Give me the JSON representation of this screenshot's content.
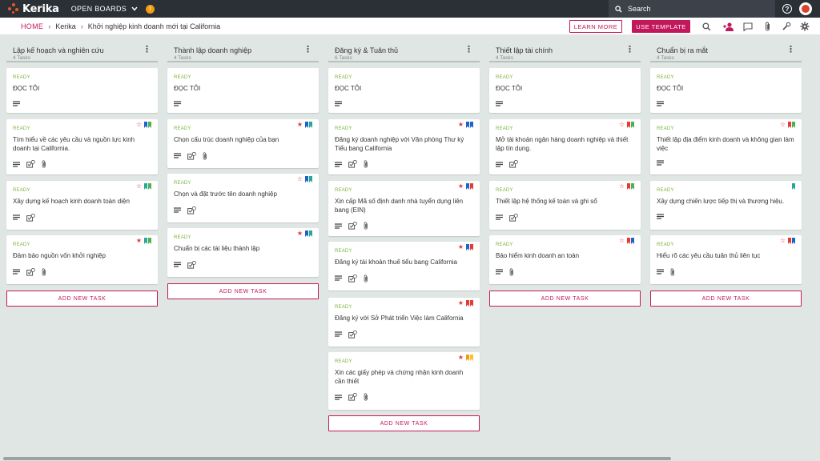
{
  "app": {
    "name": "Kerika",
    "open_boards": "OPEN BOARDS",
    "notification_icon": "lightbulb-icon"
  },
  "search": {
    "placeholder": "Search"
  },
  "breadcrumb": {
    "home": "HOME",
    "org": "Kerika",
    "board": "Khởi nghiệp kinh doanh mới tại California"
  },
  "toolbar": {
    "learn_more": "LEARN MORE",
    "use_template": "USE TEMPLATE"
  },
  "colors": {
    "accent": "#c2185b",
    "ready": "#7cb342",
    "red": "#e53935",
    "blue": "#1e63c8",
    "green": "#4caf50",
    "teal": "#26a69a",
    "orange": "#f39c12",
    "yellow": "#fbc02d"
  },
  "add_task_label": "ADD NEW TASK",
  "columns": [
    {
      "title": "Lập kế hoạch và nghiên cứu",
      "count": "4 Tasks",
      "cards": [
        {
          "status": "READY",
          "title": "ĐỌC TÔI",
          "star": "",
          "tags": []
        },
        {
          "status": "READY",
          "title": "Tìm hiểu về các yêu cầu và nguồn lực kinh doanh tại California.",
          "star": "outline",
          "tags": [
            "blue",
            "green"
          ]
        },
        {
          "status": "READY",
          "title": "Xây dựng kế hoạch kinh doanh toàn diện",
          "star": "outline",
          "tags": [
            "teal",
            "green"
          ]
        },
        {
          "status": "READY",
          "title": "Đảm bảo nguồn vốn khởi nghiệp",
          "star": "filled",
          "tags": [
            "teal",
            "green"
          ]
        }
      ]
    },
    {
      "title": "Thành lập doanh nghiệp",
      "count": "4 Tasks",
      "cards": [
        {
          "status": "READY",
          "title": "ĐỌC TÔI",
          "star": "",
          "tags": []
        },
        {
          "status": "READY",
          "title": "Chọn cấu trúc doanh nghiệp của bạn",
          "star": "filled",
          "tags": [
            "blue",
            "teal"
          ]
        },
        {
          "status": "READY",
          "title": "Chọn và đặt trước tên doanh nghiệp",
          "star": "outline",
          "tags": [
            "blue",
            "teal"
          ]
        },
        {
          "status": "READY",
          "title": "Chuẩn bị các tài liệu thành lập",
          "star": "filled",
          "tags": [
            "blue",
            "teal"
          ]
        }
      ]
    },
    {
      "title": "Đăng ký & Tuân thủ",
      "count": "6 Tasks",
      "cards": [
        {
          "status": "READY",
          "title": "ĐỌC TÔI",
          "star": "",
          "tags": []
        },
        {
          "status": "READY",
          "title": "Đăng ký doanh nghiệp với Văn phòng Thư ký Tiểu bang California",
          "star": "filled",
          "tags": [
            "blue",
            "blue"
          ]
        },
        {
          "status": "READY",
          "title": "Xin cấp Mã số định danh nhà tuyển dụng liên bang (EIN)",
          "star": "filled",
          "tags": [
            "blue",
            "red"
          ]
        },
        {
          "status": "READY",
          "title": "Đăng ký tài khoản thuế tiểu bang California",
          "star": "filled",
          "tags": [
            "blue",
            "red"
          ]
        },
        {
          "status": "READY",
          "title": "Đăng ký với Sở Phát triển Việc làm California",
          "star": "filled",
          "tags": [
            "red",
            "red"
          ]
        },
        {
          "status": "READY",
          "title": "Xin các giấy phép và chứng nhận kinh doanh cần thiết",
          "star": "filled",
          "tags": [
            "orange",
            "yellow"
          ]
        }
      ]
    },
    {
      "title": "Thiết lập tài chính",
      "count": "4 Tasks",
      "cards": [
        {
          "status": "READY",
          "title": "ĐỌC TÔI",
          "star": "",
          "tags": []
        },
        {
          "status": "READY",
          "title": "Mở tài khoản ngân hàng doanh nghiệp và thiết lập tín dụng.",
          "star": "outline",
          "tags": [
            "red",
            "green"
          ]
        },
        {
          "status": "READY",
          "title": "Thiết lập hệ thống kế toán và ghi sổ",
          "star": "outline",
          "tags": [
            "red",
            "green"
          ]
        },
        {
          "status": "READY",
          "title": "Bảo hiểm kinh doanh an toàn",
          "star": "outline",
          "tags": [
            "red",
            "blue"
          ]
        }
      ]
    },
    {
      "title": "Chuẩn bị ra mắt",
      "count": "4 Tasks",
      "cards": [
        {
          "status": "READY",
          "title": "ĐỌC TÔI",
          "star": "",
          "tags": []
        },
        {
          "status": "READY",
          "title": "Thiết lập địa điểm kinh doanh và không gian làm việc",
          "star": "outline",
          "tags": [
            "red",
            "green"
          ]
        },
        {
          "status": "READY",
          "title": "Xây dựng chiến lược tiếp thị và thương hiệu.",
          "star": "",
          "tags": [
            "teal"
          ]
        },
        {
          "status": "READY",
          "title": "Hiểu rõ các yêu cầu tuân thủ liên tục",
          "star": "outline",
          "tags": [
            "red",
            "blue"
          ]
        }
      ]
    }
  ]
}
